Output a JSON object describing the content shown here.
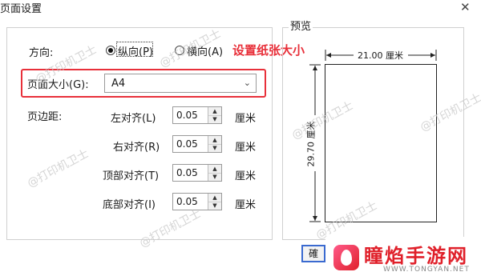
{
  "window": {
    "title": "页面设置",
    "close_glyph": "✕"
  },
  "orientation": {
    "label": "方向:",
    "portrait_label": "纵向(P)",
    "landscape_label": "横向(A)",
    "selected": "portrait"
  },
  "page_size": {
    "label": "页面大小(G):",
    "value": "A4",
    "chevron": "⌄"
  },
  "annotation": {
    "text": "设置纸张大小",
    "color": "#e8303a"
  },
  "margins": {
    "label": "页边距:",
    "unit": "厘米",
    "rows": [
      {
        "label": "左对齐(L)",
        "value": "0.05"
      },
      {
        "label": "右对齐(R)",
        "value": "0.05"
      },
      {
        "label": "顶部对齐(T)",
        "value": "0.05"
      },
      {
        "label": "底部对齐(I)",
        "value": "0.05"
      }
    ]
  },
  "preview": {
    "title": "预览",
    "width_label": "21.00  厘米",
    "height_label": "29.70  厘米"
  },
  "ok_button": {
    "label": "確"
  },
  "watermark": {
    "text": "@打印机卫士"
  },
  "brand": {
    "name": "瞳焰手游网",
    "url": "WWW.TONGYAN.NET",
    "accent": "#e0202a"
  },
  "icons": {
    "spin_up": "▲",
    "spin_down": "▼"
  }
}
